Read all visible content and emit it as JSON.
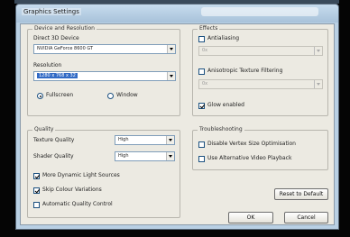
{
  "window": {
    "title": "Graphics Settings"
  },
  "device_resolution": {
    "group_label": "Device and Resolution",
    "direct3d_label": "Direct 3D Device",
    "direct3d_value": "NVIDIA GeForce 8600 GT",
    "resolution_label": "Resolution",
    "resolution_value": "1280 x 768 x 32",
    "fullscreen_label": "Fullscreen",
    "window_label": "Window",
    "fullscreen_selected": true
  },
  "quality": {
    "group_label": "Quality",
    "texture_label": "Texture Quality",
    "texture_value": "High",
    "shader_label": "Shader Quality",
    "shader_value": "High",
    "options": [
      {
        "label": "More Dynamic Light Sources",
        "checked": true
      },
      {
        "label": "Skip Colour Variations",
        "checked": true
      },
      {
        "label": "Automatic Quality Control",
        "checked": false
      }
    ]
  },
  "effects": {
    "group_label": "Effects",
    "antialiasing_label": "Antialiasing",
    "antialiasing_value": "0x",
    "anisotropic_label": "Anisotropic Texture Filtering",
    "anisotropic_value": "0x",
    "glow_label": "Glow enabled",
    "glow_checked": true
  },
  "troubleshooting": {
    "group_label": "Troubleshooting",
    "options": [
      {
        "label": "Disable Vertex Size Optimisation",
        "checked": false
      },
      {
        "label": "Use Alternative Video Playback",
        "checked": false
      }
    ]
  },
  "buttons": {
    "reset": "Reset to Default",
    "ok": "OK",
    "cancel": "Cancel"
  }
}
